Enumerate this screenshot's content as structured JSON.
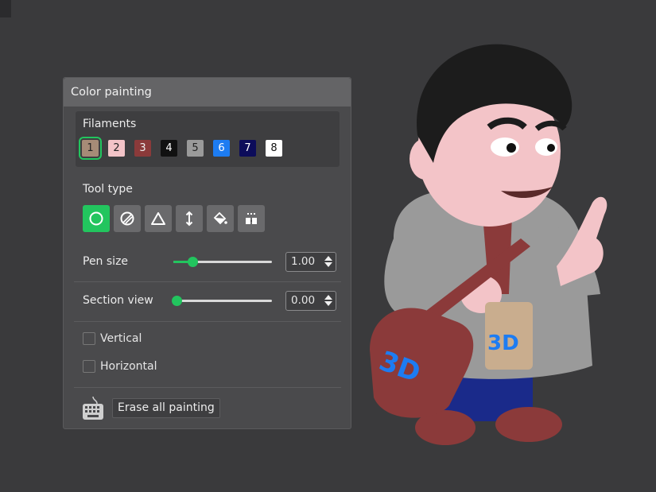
{
  "panel": {
    "title": "Color painting",
    "filaments_label": "Filaments",
    "filaments": [
      {
        "label": "1",
        "bg": "#a68b77",
        "fg": "#222222",
        "selected": true
      },
      {
        "label": "2",
        "bg": "#f3c4c8",
        "fg": "#222222",
        "selected": false
      },
      {
        "label": "3",
        "bg": "#8b3a3a",
        "fg": "#eeeeee",
        "selected": false
      },
      {
        "label": "4",
        "bg": "#111111",
        "fg": "#ffffff",
        "selected": false
      },
      {
        "label": "5",
        "bg": "#9a9a9a",
        "fg": "#222222",
        "selected": false
      },
      {
        "label": "6",
        "bg": "#1d7cf2",
        "fg": "#ffffff",
        "selected": false
      },
      {
        "label": "7",
        "bg": "#0c0c5a",
        "fg": "#ffffff",
        "selected": false
      },
      {
        "label": "8",
        "bg": "#ffffff",
        "fg": "#111111",
        "selected": false
      }
    ],
    "tool_type_label": "Tool type",
    "tools": [
      {
        "icon": "circle-brush-icon",
        "active": true
      },
      {
        "icon": "sphere-brush-icon",
        "active": false
      },
      {
        "icon": "triangle-icon",
        "active": false
      },
      {
        "icon": "height-range-icon",
        "active": false
      },
      {
        "icon": "fill-bucket-icon",
        "active": false
      },
      {
        "icon": "gap-fill-icon",
        "active": false
      }
    ],
    "pen_size": {
      "label": "Pen size",
      "value": "1.00",
      "level": 0.16
    },
    "section_view": {
      "label": "Section view",
      "value": "0.00",
      "level": 0.0
    },
    "vertical_label": "Vertical",
    "horizontal_label": "Horizontal",
    "erase_label": "Erase all painting",
    "keyboard_icon": "keyboard-icon"
  },
  "colors": {
    "accent": "#22c55e",
    "panel_bg": "#4a4a4c",
    "header_bg": "#646466",
    "background": "#3a3a3c"
  }
}
